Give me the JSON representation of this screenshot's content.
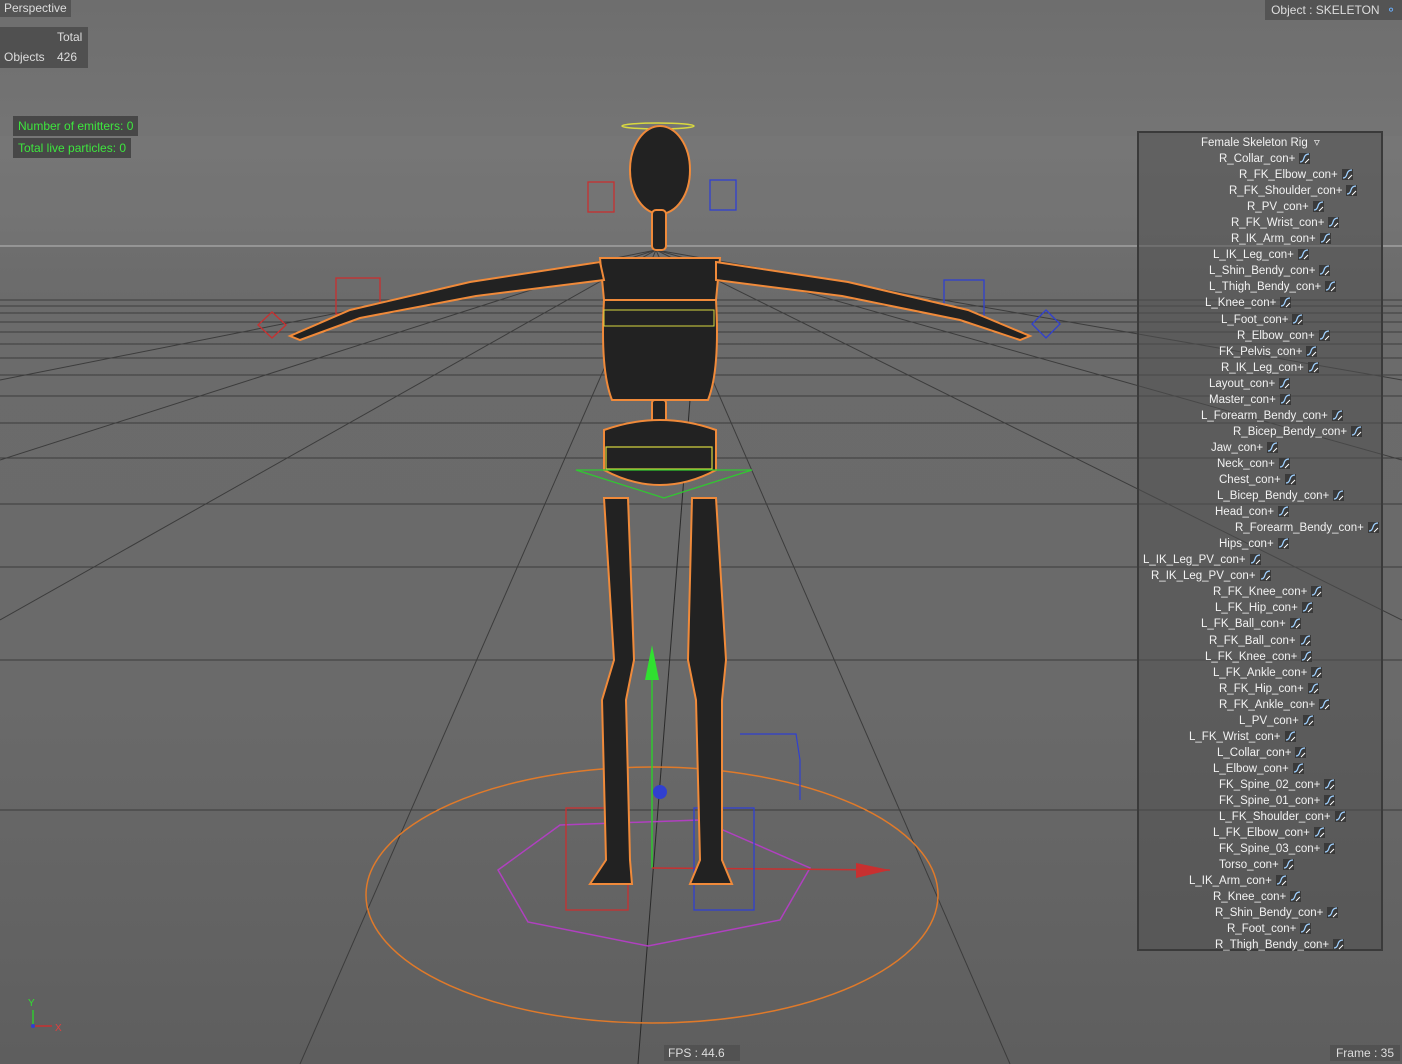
{
  "viewport": {
    "name": "Perspective"
  },
  "object_label": "Object : SKELETON",
  "stats": {
    "header": "Total",
    "objects_label": "Objects",
    "objects_value": "426"
  },
  "particles": {
    "emitters": "Number of emitters: 0",
    "live": "Total live particles: 0"
  },
  "rig": {
    "title": "Female Skeleton Rig",
    "items": [
      "R_Collar_con+",
      "R_FK_Elbow_con+",
      "R_FK_Shoulder_con+",
      "R_PV_con+",
      "R_FK_Wrist_con+",
      "R_IK_Arm_con+",
      "L_IK_Leg_con+",
      "L_Shin_Bendy_con+",
      "L_Thigh_Bendy_con+",
      "L_Knee_con+",
      "L_Foot_con+",
      "R_Elbow_con+",
      "FK_Pelvis_con+",
      "R_IK_Leg_con+",
      "Layout_con+",
      "Master_con+",
      "L_Forearm_Bendy_con+",
      "R_Bicep_Bendy_con+",
      "Jaw_con+",
      "Neck_con+",
      "Chest_con+",
      "L_Bicep_Bendy_con+",
      "Head_con+",
      "R_Forearm_Bendy_con+",
      "Hips_con+",
      "L_IK_Leg_PV_con+",
      "R_IK_Leg_PV_con+",
      "R_FK_Knee_con+",
      "L_FK_Hip_con+",
      "L_FK_Ball_con+",
      "R_FK_Ball_con+",
      "L_FK_Knee_con+",
      "L_FK_Ankle_con+",
      "R_FK_Hip_con+",
      "R_FK_Ankle_con+",
      "L_PV_con+",
      "L_FK_Wrist_con+",
      "L_Collar_con+",
      "L_Elbow_con+",
      "FK_Spine_02_con+",
      "FK_Spine_01_con+",
      "L_FK_Shoulder_con+",
      "L_FK_Elbow_con+",
      "FK_Spine_03_con+",
      "Torso_con+",
      "L_IK_Arm_con+",
      "R_Knee_con+",
      "R_Shin_Bendy_con+",
      "R_Foot_con+",
      "R_Thigh_Bendy_con+"
    ]
  },
  "axis": {
    "y": "Y",
    "x": "X"
  },
  "fps": "FPS : 44.6",
  "frame": "Frame : 35",
  "colors": {
    "selection": "#f08a3a",
    "emitter_text": "#3ee63e",
    "x_axis": "#c83030",
    "y_axis": "#30c830",
    "z_axis": "#3040d0",
    "ring": "#e07a2a",
    "hex": "#b040c0"
  }
}
